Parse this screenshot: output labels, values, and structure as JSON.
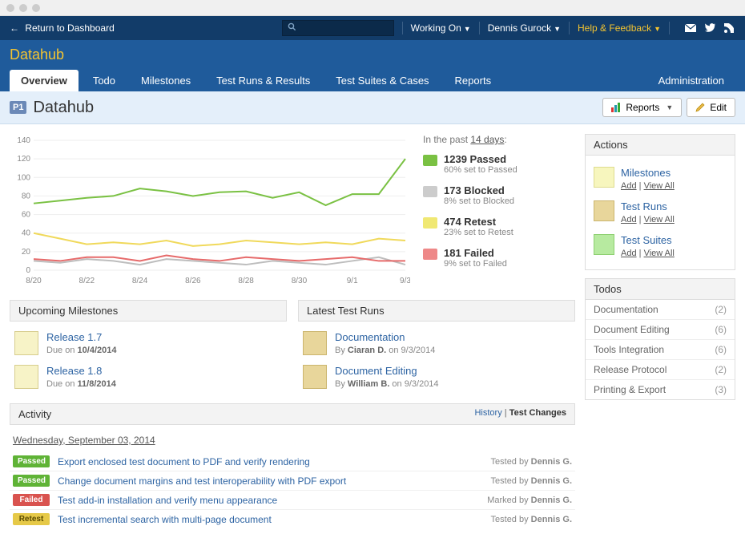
{
  "titlebar": {},
  "topstrip": {
    "return": "Return to Dashboard",
    "search_placeholder": "",
    "working_on": "Working On",
    "user": "Dennis Gurock",
    "help": "Help & Feedback"
  },
  "header": {
    "project": "Datahub",
    "tabs": [
      "Overview",
      "Todo",
      "Milestones",
      "Test Runs & Results",
      "Test Suites & Cases",
      "Reports"
    ],
    "active_tab": 0,
    "admin": "Administration"
  },
  "subhead": {
    "badge": "P1",
    "title": "Datahub",
    "reports_btn": "Reports",
    "edit_btn": "Edit"
  },
  "chart_data": {
    "type": "line",
    "x": [
      "8/20",
      "8/21",
      "8/22",
      "8/23",
      "8/24",
      "8/25",
      "8/26",
      "8/27",
      "8/28",
      "8/29",
      "8/30",
      "8/31",
      "9/1",
      "9/2",
      "9/3"
    ],
    "xticks": [
      "8/20",
      "8/22",
      "8/24",
      "8/26",
      "8/28",
      "8/30",
      "9/1",
      "9/3"
    ],
    "ylim": [
      0,
      140
    ],
    "yticks": [
      0,
      20,
      40,
      60,
      80,
      100,
      120,
      140
    ],
    "series": [
      {
        "name": "Passed",
        "color": "#7ac143",
        "values": [
          72,
          75,
          78,
          80,
          88,
          85,
          80,
          84,
          85,
          78,
          84,
          70,
          82,
          82,
          120
        ]
      },
      {
        "name": "Blocked",
        "color": "#bdbdbd",
        "values": [
          10,
          8,
          12,
          10,
          6,
          12,
          10,
          8,
          6,
          10,
          8,
          6,
          10,
          14,
          6
        ]
      },
      {
        "name": "Retest",
        "color": "#f0d95b",
        "values": [
          40,
          34,
          28,
          30,
          28,
          32,
          26,
          28,
          32,
          30,
          28,
          30,
          28,
          34,
          32
        ]
      },
      {
        "name": "Failed",
        "color": "#e66a6a",
        "values": [
          12,
          10,
          14,
          14,
          10,
          16,
          12,
          10,
          14,
          12,
          10,
          12,
          14,
          10,
          10
        ]
      }
    ]
  },
  "summary": {
    "lead_a": "In the past ",
    "lead_b": "14 days",
    "lead_c": ":",
    "items": [
      {
        "class": "p",
        "count": "1239",
        "label": "Passed",
        "sub": "60% set to Passed"
      },
      {
        "class": "b",
        "count": "173",
        "label": "Blocked",
        "sub": "8% set to Blocked"
      },
      {
        "class": "r",
        "count": "474",
        "label": "Retest",
        "sub": "23% set to Retest"
      },
      {
        "class": "f",
        "count": "181",
        "label": "Failed",
        "sub": "9% set to Failed"
      }
    ]
  },
  "milestones_hdr": "Upcoming Milestones",
  "milestones": [
    {
      "title": "Release 1.7",
      "sub_a": "Due on ",
      "sub_b": "10/4/2014"
    },
    {
      "title": "Release 1.8",
      "sub_a": "Due on ",
      "sub_b": "11/8/2014"
    }
  ],
  "testruns_hdr": "Latest Test Runs",
  "testruns": [
    {
      "title": "Documentation",
      "sub_a": "By ",
      "author": "Ciaran D.",
      "sub_b": " on 9/3/2014"
    },
    {
      "title": "Document Editing",
      "sub_a": "By ",
      "author": "William B.",
      "sub_b": " on 9/3/2014"
    }
  ],
  "activity": {
    "hdr": "Activity",
    "history": "History",
    "testchanges": "Test Changes",
    "date": "Wednesday, September 03, 2014",
    "rows": [
      {
        "status": "Passed",
        "cls": "p",
        "desc": "Export enclosed test document to PDF and verify rendering",
        "by": "Tested by ",
        "who": "Dennis G."
      },
      {
        "status": "Passed",
        "cls": "p",
        "desc": "Change document margins and test interoperability with PDF export",
        "by": "Tested by ",
        "who": "Dennis G."
      },
      {
        "status": "Failed",
        "cls": "f",
        "desc": "Test add-in installation and verify menu appearance",
        "by": "Marked by ",
        "who": "Dennis G."
      },
      {
        "status": "Retest",
        "cls": "r",
        "desc": "Test incremental search with multi-page document",
        "by": "Tested by ",
        "who": "Dennis G."
      }
    ]
  },
  "sidebar": {
    "actions_hdr": "Actions",
    "actions": [
      {
        "cls": "m",
        "label": "Milestones",
        "add": "Add",
        "viewall": "View All"
      },
      {
        "cls": "t",
        "label": "Test Runs",
        "add": "Add",
        "viewall": "View All"
      },
      {
        "cls": "s",
        "label": "Test Suites",
        "add": "Add",
        "viewall": "View All"
      }
    ],
    "todos_hdr": "Todos",
    "todos": [
      {
        "label": "Documentation",
        "n": "(2)"
      },
      {
        "label": "Document Editing",
        "n": "(6)"
      },
      {
        "label": "Tools Integration",
        "n": "(6)"
      },
      {
        "label": "Release Protocol",
        "n": "(2)"
      },
      {
        "label": "Printing & Export",
        "n": "(3)"
      }
    ]
  }
}
